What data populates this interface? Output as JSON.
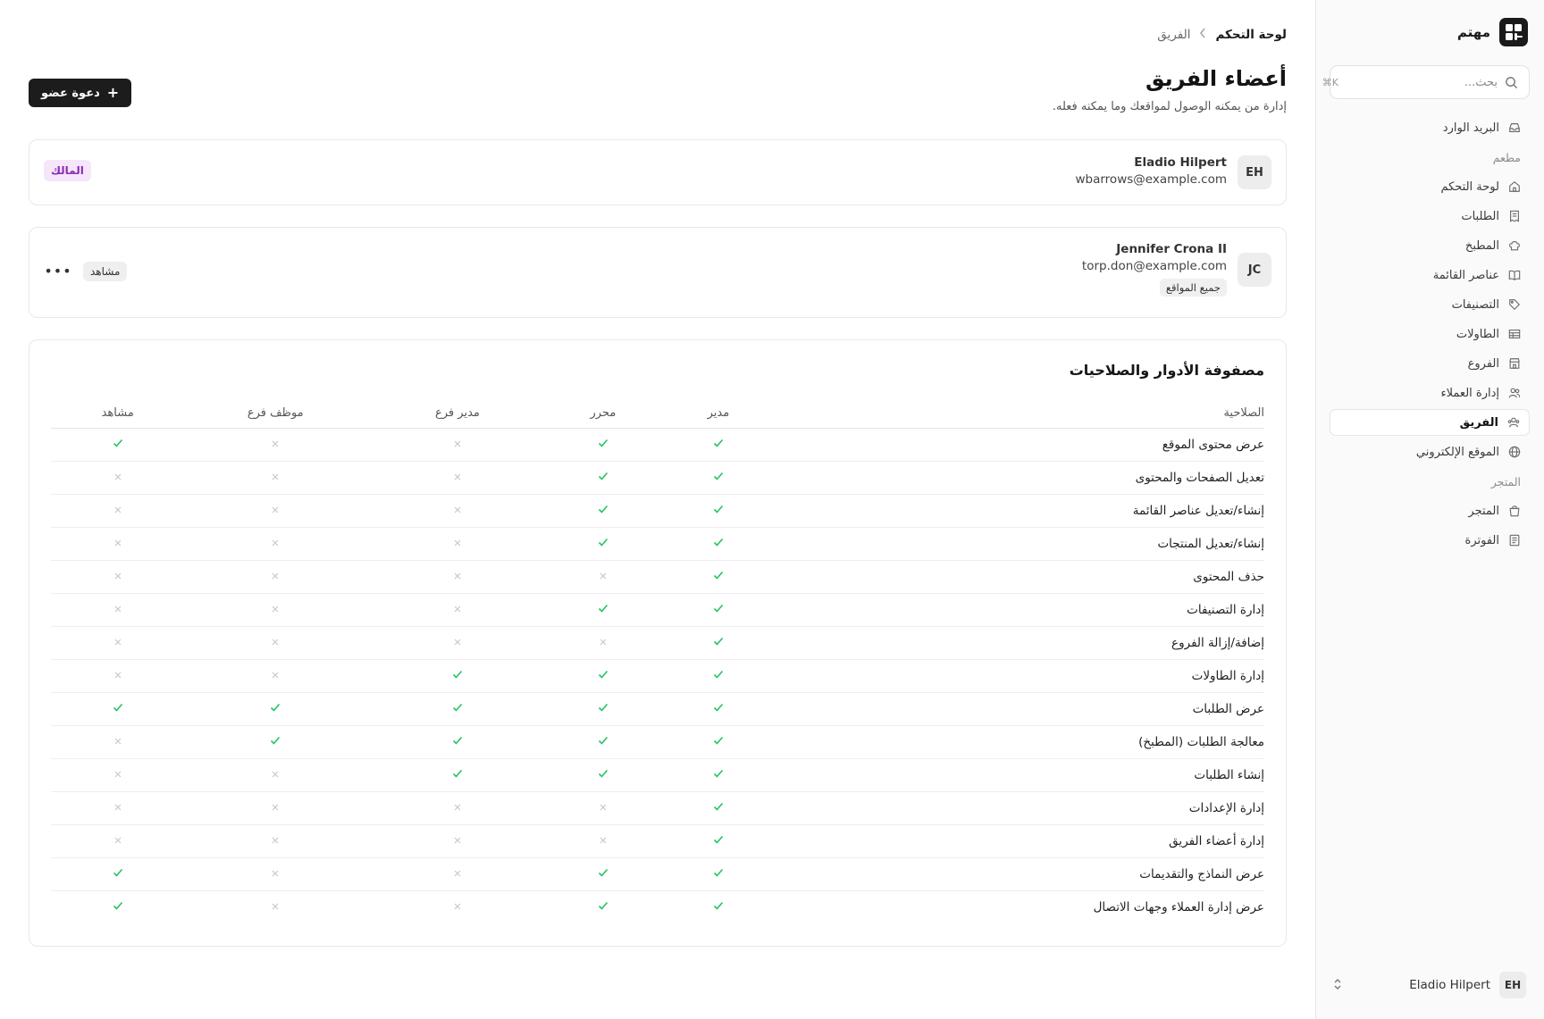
{
  "sidebar": {
    "brand_name": "مهتم",
    "search": {
      "placeholder": "بحث...",
      "shortcut": "⌘K"
    },
    "nav": [
      {
        "type": "item",
        "label": "البريد الوارد",
        "icon": "inbox-icon"
      },
      {
        "type": "section",
        "label": "مطعم"
      },
      {
        "type": "item",
        "label": "لوحة التحكم",
        "icon": "home-icon"
      },
      {
        "type": "item",
        "label": "الطلبات",
        "icon": "receipt-icon"
      },
      {
        "type": "item",
        "label": "المطبخ",
        "icon": "chef-hat-icon"
      },
      {
        "type": "item",
        "label": "عناصر القائمة",
        "icon": "book-open-icon"
      },
      {
        "type": "item",
        "label": "التصنيفات",
        "icon": "tag-icon"
      },
      {
        "type": "item",
        "label": "الطاولات",
        "icon": "table-icon"
      },
      {
        "type": "item",
        "label": "الفروع",
        "icon": "store-icon"
      },
      {
        "type": "item",
        "label": "إدارة العملاء",
        "icon": "users-icon"
      },
      {
        "type": "item",
        "label": "الفريق",
        "icon": "team-icon",
        "active": true
      },
      {
        "type": "item",
        "label": "الموقع الإلكتروني",
        "icon": "globe-icon"
      },
      {
        "type": "section",
        "label": "المتجر"
      },
      {
        "type": "item",
        "label": "المتجر",
        "icon": "shopping-bag-icon"
      },
      {
        "type": "item",
        "label": "الفوترة",
        "icon": "invoice-icon"
      }
    ],
    "user": {
      "initials": "EH",
      "name": "Eladio Hilpert"
    }
  },
  "header": {
    "breadcrumb": {
      "root": "لوحة التحكم",
      "current": "الفريق"
    },
    "title": "أعضاء الفريق",
    "subtitle": "إدارة من يمكنه الوصول لمواقعك وما يمكنه فعله.",
    "invite_label": "دعوة عضو"
  },
  "members": [
    {
      "initials": "EH",
      "name": "Eladio Hilpert",
      "email": "wbarrows@example.com",
      "role": "المالك"
    },
    {
      "initials": "JC",
      "name": "Jennifer Crona II",
      "email": "torp.don@example.com",
      "scope": "جميع المواقع",
      "role": "مشاهد"
    }
  ],
  "matrix": {
    "title": "مصفوفة الأدوار والصلاحيات",
    "permission_header": "الصلاحية",
    "roles": [
      "مدير",
      "محرر",
      "مدير فرع",
      "موظف فرع",
      "مشاهد"
    ],
    "rows": [
      {
        "permission": "عرض محتوى الموقع",
        "access": [
          true,
          true,
          false,
          false,
          true
        ]
      },
      {
        "permission": "تعديل الصفحات والمحتوى",
        "access": [
          true,
          true,
          false,
          false,
          false
        ]
      },
      {
        "permission": "إنشاء/تعديل عناصر القائمة",
        "access": [
          true,
          true,
          false,
          false,
          false
        ]
      },
      {
        "permission": "إنشاء/تعديل المنتجات",
        "access": [
          true,
          true,
          false,
          false,
          false
        ]
      },
      {
        "permission": "حذف المحتوى",
        "access": [
          true,
          false,
          false,
          false,
          false
        ]
      },
      {
        "permission": "إدارة التصنيفات",
        "access": [
          true,
          true,
          false,
          false,
          false
        ]
      },
      {
        "permission": "إضافة/إزالة الفروع",
        "access": [
          true,
          false,
          false,
          false,
          false
        ]
      },
      {
        "permission": "إدارة الطاولات",
        "access": [
          true,
          true,
          true,
          false,
          false
        ]
      },
      {
        "permission": "عرض الطلبات",
        "access": [
          true,
          true,
          true,
          true,
          true
        ]
      },
      {
        "permission": "معالجة الطلبات (المطبخ)",
        "access": [
          true,
          true,
          true,
          true,
          false
        ]
      },
      {
        "permission": "إنشاء الطلبات",
        "access": [
          true,
          true,
          true,
          false,
          false
        ]
      },
      {
        "permission": "إدارة الإعدادات",
        "access": [
          true,
          false,
          false,
          false,
          false
        ]
      },
      {
        "permission": "إدارة أعضاء الفريق",
        "access": [
          true,
          false,
          false,
          false,
          false
        ]
      },
      {
        "permission": "عرض النماذج والتقديمات",
        "access": [
          true,
          true,
          false,
          false,
          true
        ]
      },
      {
        "permission": "عرض إدارة العملاء وجهات الاتصال",
        "access": [
          true,
          true,
          false,
          false,
          true
        ]
      }
    ]
  },
  "colors": {
    "accent_check": "#22c55e",
    "owner_badge_bg": "#f5e6fb",
    "owner_badge_text": "#8a2bb5",
    "primary_button": "#1c1c1c"
  }
}
